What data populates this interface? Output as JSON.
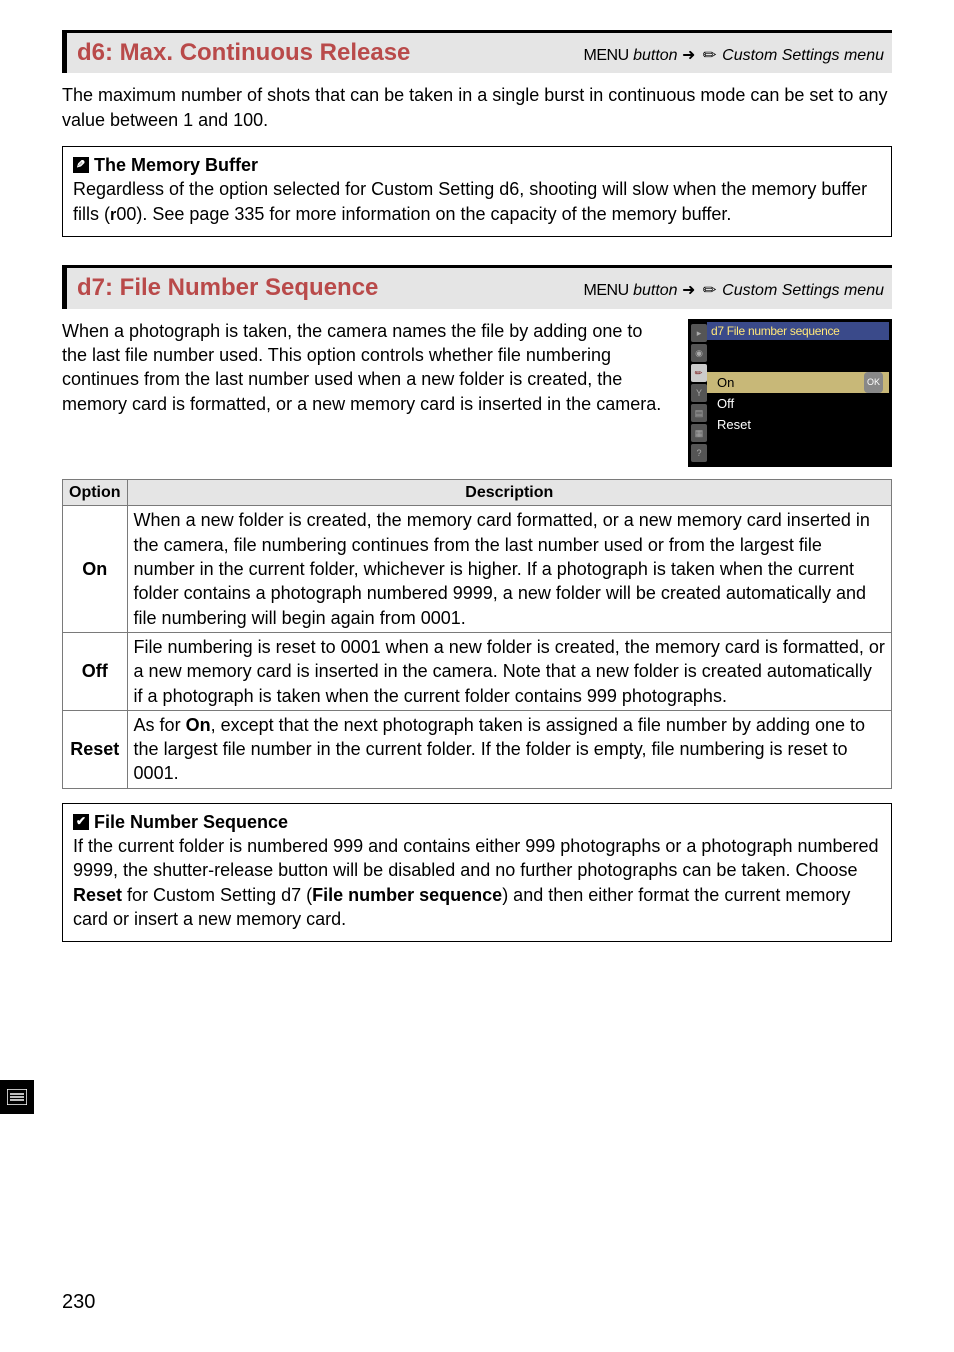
{
  "d6": {
    "heading": "d6: Max.  Continuous Release",
    "menu_literal": "MENU",
    "menu_button_word": " button  ",
    "menu_path_rest": " Custom Settings menu",
    "body": "The maximum number of shots that can be taken in a single burst in continuous mode can be set to any value between 1 and 100.",
    "note_title": " The Memory Buffer",
    "note_body_a": "Regardless of the option selected for Custom Setting d6, shooting will slow when the memory buffer fills (",
    "note_body_b": "00).  See page 335 for more information on the capacity of the memory buffer."
  },
  "d7": {
    "heading": "d7: File Number Sequence",
    "menu_literal": "MENU",
    "menu_button_word": " button  ",
    "menu_path_rest": " Custom Settings menu",
    "intro": "When a photograph is taken, the camera names the file by adding one to the last file number used.  This option controls whether file numbering continues from the last number used when a new folder is created, the memory card is formatted, or a new memory card is inserted in the camera.",
    "lcd": {
      "title": "d7 File number sequence",
      "rows": [
        "On",
        "Off",
        "Reset"
      ],
      "ok": "OK"
    },
    "table": {
      "h_option": "Option",
      "h_desc": "Description",
      "rows": [
        {
          "opt": "On",
          "desc": "When a new folder is created, the memory card formatted, or a new memory card inserted in the camera, file numbering continues from the last number used or from the largest file number in the current folder, whichever is higher.  If a photograph is taken when the current folder contains a photograph numbered 9999, a new folder will be created automatically and file numbering will begin again from 0001."
        },
        {
          "opt": "Off",
          "desc": "File numbering is reset to 0001 when a new folder is created, the memory card is formatted, or a new memory card is inserted in the camera.  Note that a new folder is created automatically if a photograph is taken when the current folder contains 999 photographs."
        },
        {
          "opt": "Reset",
          "desc_a": "As for ",
          "desc_bold": "On",
          "desc_b": ", except that the next photograph taken is assigned a file number by adding one to the largest file number in the current folder.  If the folder is empty, file numbering is reset to 0001."
        }
      ]
    },
    "note2": {
      "title": " File Number Sequence",
      "body_a": "If the current folder is numbered 999 and contains either 999 photographs or a photograph numbered 9999, the shutter-release button will be disabled and no further photographs can be taken.  Choose ",
      "bold1": "Reset",
      "body_b": " for Custom Setting d7 (",
      "bold2": "File number sequence",
      "body_c": ") and then either format the current memory card or insert a new memory card."
    }
  },
  "page_number": "230"
}
